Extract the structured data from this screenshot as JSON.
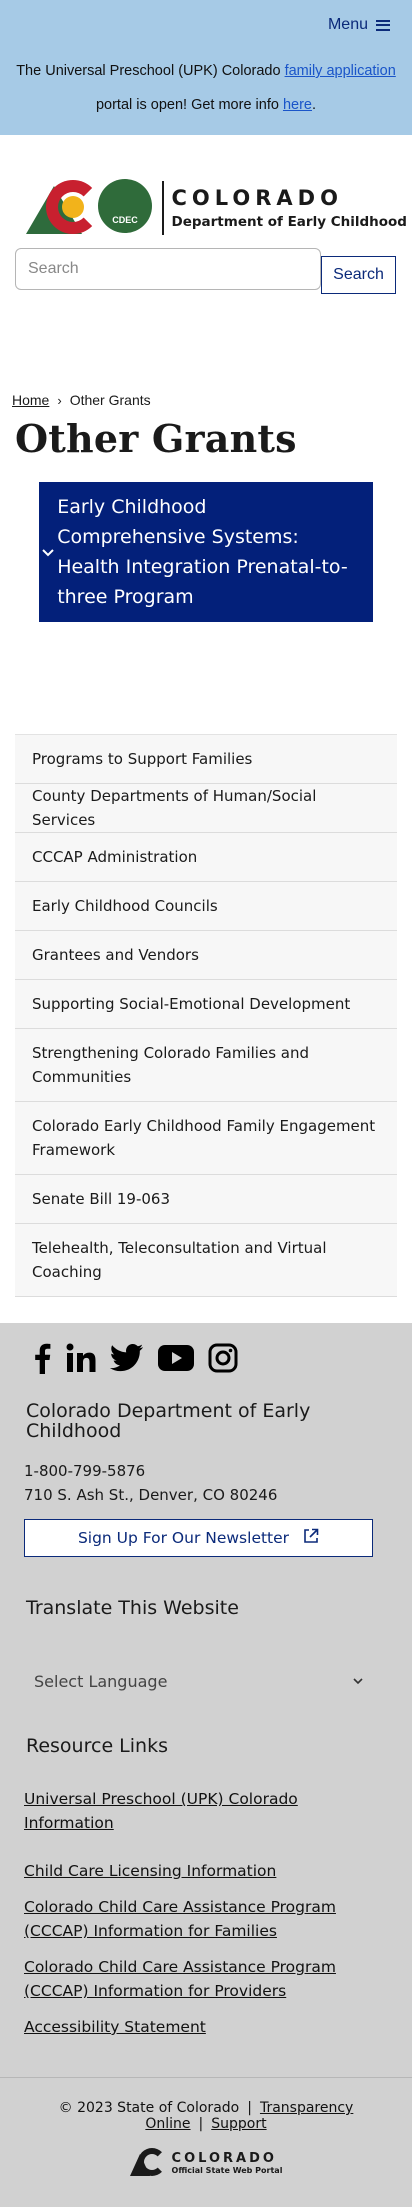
{
  "alert": {
    "menu_label": "Menu",
    "text_1": "The Universal Preschool (UPK) Colorado ",
    "link_family_application": "family application",
    "text_2": "portal is open! Get more info ",
    "link_here": "here",
    "text_3": ".",
    "background_color": "#a6cae6"
  },
  "header": {
    "logo_title": "COLORADO",
    "logo_subtitle": "Department of Early Childhood",
    "logo_badge": "CDEC",
    "search_placeholder": "Search",
    "search_button": "Search"
  },
  "breadcrumb": {
    "home": "Home",
    "separator": "›",
    "current": "Other Grants"
  },
  "page_title": "Other Grants",
  "accordion": {
    "label": "Early Childhood Comprehensive Systems: Health Integration Prenatal-to-three Program",
    "icon": "chevron-down-icon",
    "color": "#03207a"
  },
  "related_links": [
    "Programs to Support Families",
    "County Departments of Human/Social Services",
    "CCCAP Administration",
    "Early Childhood Councils",
    "Grantees and Vendors",
    "Supporting Social-Emotional Development",
    "Strengthening Colorado Families and Communities",
    "Colorado Early Childhood Family Engagement Framework",
    "Senate Bill 19-063",
    "Telehealth, Teleconsultation and Virtual Coaching"
  ],
  "footer": {
    "social_icons": [
      "facebook-icon",
      "linkedin-icon",
      "twitter-icon",
      "youtube-icon",
      "instagram-icon"
    ],
    "org_name": "Colorado Department of Early Childhood",
    "phone": "1-800-799-5876",
    "address": "710 S. Ash St., Denver, CO 80246",
    "newsletter_label": "Sign Up For Our Newsletter",
    "translate_title": "Translate This Website",
    "language_select": "Select Language",
    "resource_title": "Resource Links",
    "resource_links": [
      "Universal Preschool (UPK) Colorado Information",
      "Child Care Licensing Information",
      "Colorado Child Care Assistance Program (CCCAP) Information for Families",
      "Colorado Child Care Assistance Program (CCCAP) Information for Providers",
      "Accessibility Statement"
    ],
    "copyright": "© 2023 State of Colorado",
    "transparency": "Transparency Online",
    "support": "Support",
    "portal_title": "COLORADO",
    "portal_subtitle": "Official State Web Portal",
    "background_color": "#d1d1d1"
  }
}
